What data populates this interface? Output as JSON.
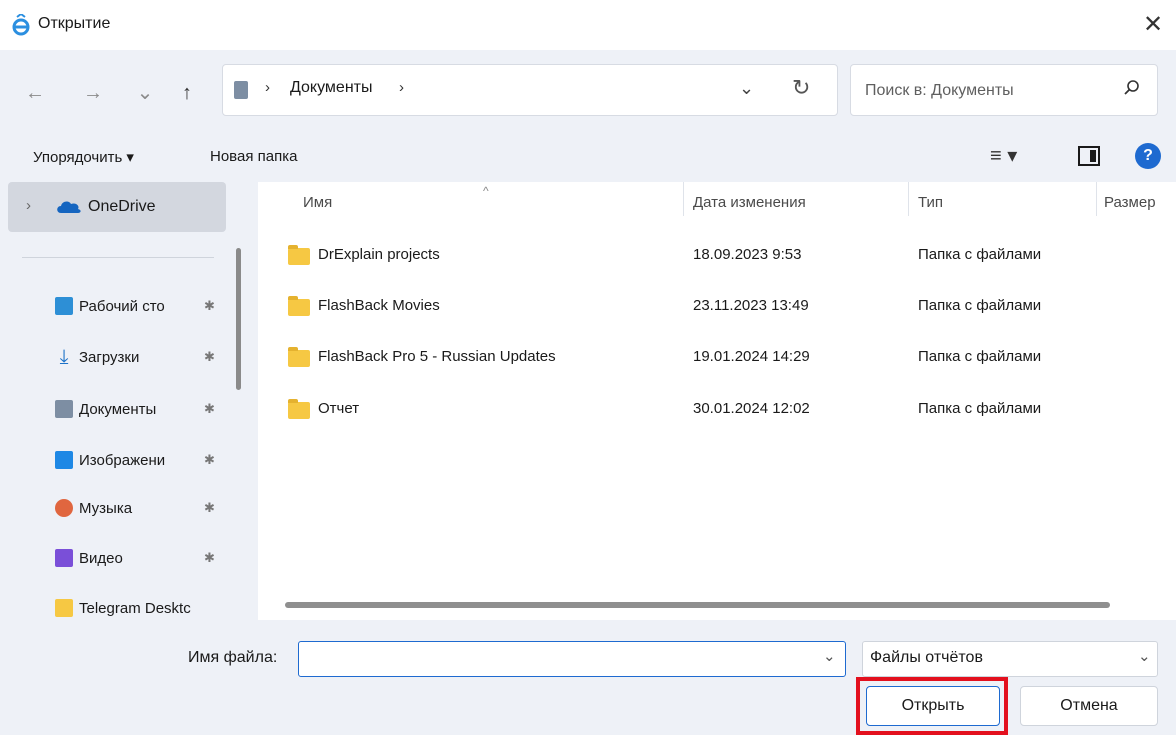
{
  "window": {
    "title": "Открытие",
    "close_glyph": "✕"
  },
  "nav": {
    "back_glyph": "←",
    "forward_glyph": "→",
    "recent_glyph": "⌄",
    "up_glyph": "↑"
  },
  "address": {
    "chevron": "›",
    "path": "Документы",
    "chevron2": "›",
    "dropdown_glyph": "⌄",
    "refresh_glyph": "↻"
  },
  "search": {
    "placeholder": "Поиск в: Документы"
  },
  "toolbar": {
    "organize_label": "Упорядочить ▾",
    "new_folder_label": "Новая папка",
    "view_glyph": "≡ ▾",
    "help_glyph": "?"
  },
  "sidebar": {
    "onedrive": {
      "chevron": "›",
      "label": "OneDrive"
    },
    "items": [
      {
        "label": "Рабочий сто",
        "pin": "📌",
        "color": "#2d8fd6"
      },
      {
        "label": "Загрузки",
        "pin": "📌",
        "color": "#1e73c8"
      },
      {
        "label": "Документы",
        "pin": "📌",
        "color": "#7d8ea3"
      },
      {
        "label": "Изображени",
        "pin": "📌",
        "color": "#1e88e5"
      },
      {
        "label": "Музыка",
        "pin": "📌",
        "color": "#e0663f"
      },
      {
        "label": "Видео",
        "pin": "📌",
        "color": "#7a4fd8"
      },
      {
        "label": "Telegram Desktc",
        "pin": "",
        "color": "#f6c843"
      }
    ]
  },
  "columns": {
    "name": "Имя",
    "sort_glyph": "^",
    "modified": "Дата изменения",
    "type": "Тип",
    "size": "Размер"
  },
  "files": [
    {
      "name": "DrExplain projects",
      "modified": "18.09.2023 9:53",
      "type": "Папка с файлами"
    },
    {
      "name": "FlashBack Movies",
      "modified": "23.11.2023 13:49",
      "type": "Папка с файлами"
    },
    {
      "name": "FlashBack Pro 5 - Russian Updates",
      "modified": "19.01.2024 14:29",
      "type": "Папка с файлами"
    },
    {
      "name": "Отчет",
      "modified": "30.01.2024 12:02",
      "type": "Папка с файлами"
    }
  ],
  "footer": {
    "filename_label": "Имя файла:",
    "filename_value": "",
    "dropdown_glyph": "⌄",
    "filetype_value": "Файлы отчётов",
    "open_label": "Открыть",
    "cancel_label": "Отмена"
  }
}
